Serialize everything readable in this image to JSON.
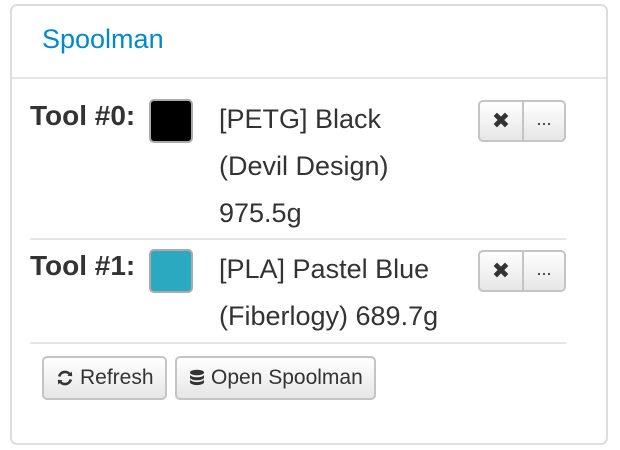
{
  "panel": {
    "title": "Spoolman"
  },
  "tools": [
    {
      "label": "Tool #0:",
      "color": "#000000",
      "spool_lines": [
        "[PETG] Black",
        "(Devil Design)",
        "975.5g"
      ],
      "clear_icon": "times-icon",
      "more_label": "..."
    },
    {
      "label": "Tool #1:",
      "color": "#2aa9c1",
      "spool_lines": [
        "[PLA] Pastel Blue",
        "(Fiberlogy) 689.7g"
      ],
      "clear_icon": "times-icon",
      "more_label": "..."
    }
  ],
  "buttons": {
    "refresh_icon": "refresh-icon",
    "refresh_label": "Refresh",
    "open_icon": "database-icon",
    "open_label": "Open Spoolman"
  }
}
